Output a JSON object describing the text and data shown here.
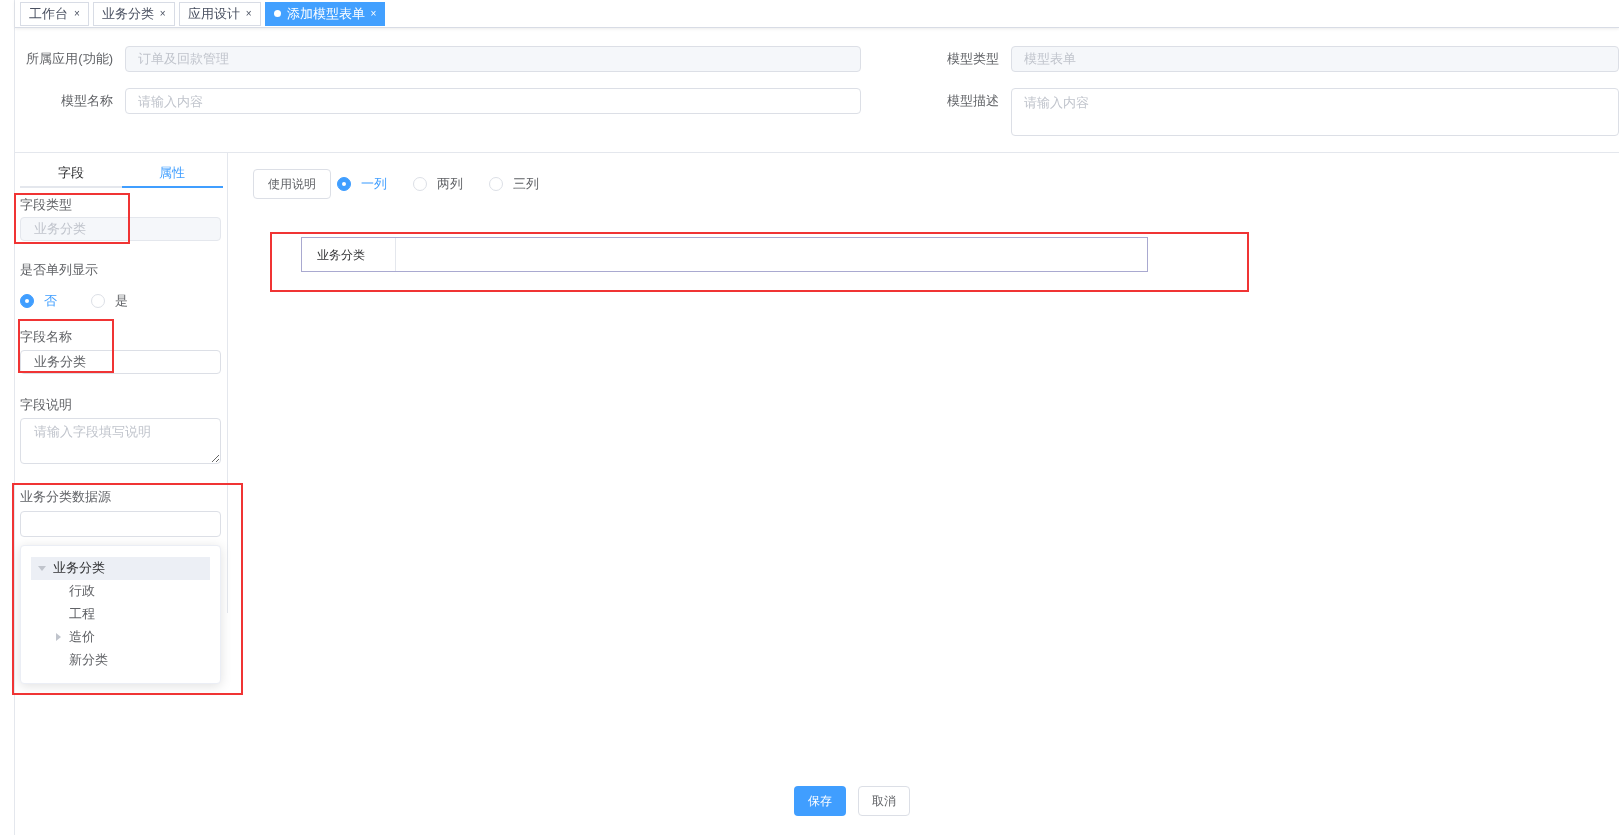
{
  "tabs": [
    {
      "label": "工作台",
      "close": "×",
      "selected": false
    },
    {
      "label": "业务分类",
      "close": "×",
      "selected": false
    },
    {
      "label": "应用设计",
      "close": "×",
      "selected": false
    },
    {
      "label": "添加模型表单",
      "close": "×",
      "selected": true
    }
  ],
  "model_form": [
    {
      "label": "所属应用(功能)",
      "value": "订单及回款管理",
      "disabled": true,
      "kind": "input"
    },
    {
      "label": "模型类型",
      "value": "模型表单",
      "disabled": true,
      "kind": "input"
    },
    {
      "label": "模型名称",
      "placeholder": "请输入内容",
      "kind": "input"
    },
    {
      "label": "模型描述",
      "placeholder": "请输入内容",
      "kind": "textarea"
    }
  ],
  "panel_tabs": [
    {
      "label": "字段",
      "selected": false
    },
    {
      "label": "属性",
      "selected": true
    }
  ],
  "properties": {
    "field_type": {
      "label": "字段类型",
      "value": "业务分类",
      "disabled": true
    },
    "single_column": {
      "label": "是否单列显示",
      "options": [
        {
          "label": "否",
          "selected": true
        },
        {
          "label": "是",
          "selected": false
        }
      ]
    },
    "field_name": {
      "label": "字段名称",
      "value": "业务分类"
    },
    "field_desc": {
      "label": "字段说明",
      "placeholder": "请输入字段填写说明"
    },
    "data_source": {
      "label": "业务分类数据源",
      "tree": [
        {
          "label": "业务分类",
          "expanded": true,
          "selected": true,
          "children": [
            {
              "label": "行政"
            },
            {
              "label": "工程"
            },
            {
              "label": "造价",
              "expanded": false
            },
            {
              "label": "新分类"
            }
          ]
        }
      ]
    }
  },
  "toolbar": {
    "help_button": "使用说明",
    "layout_options": [
      {
        "label": "一列",
        "selected": true
      },
      {
        "label": "两列",
        "selected": false
      },
      {
        "label": "三列",
        "selected": false
      }
    ]
  },
  "preview": {
    "rows": [
      {
        "label": "业务分类"
      }
    ]
  },
  "footer": {
    "save": "保存",
    "cancel": "取消"
  }
}
